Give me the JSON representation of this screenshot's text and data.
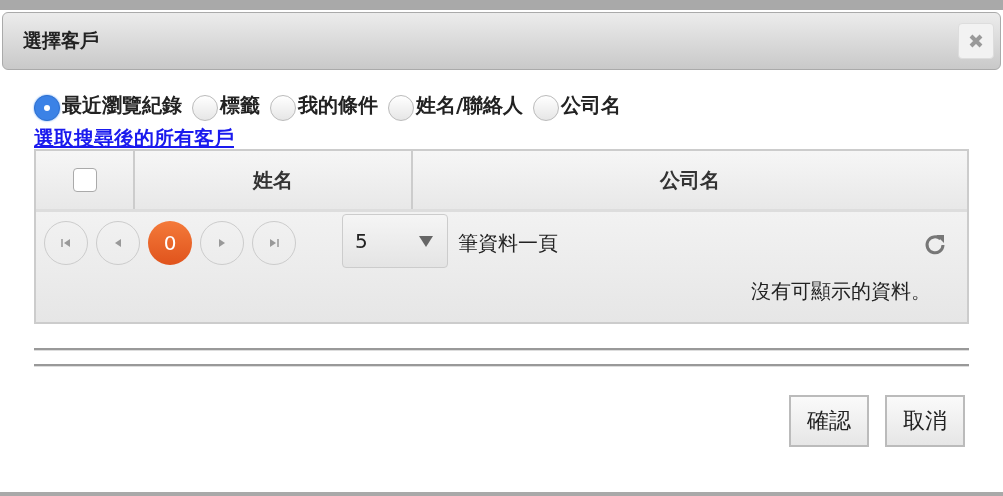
{
  "dialog": {
    "title": "選擇客戶"
  },
  "filters": [
    {
      "label": "最近瀏覽紀錄",
      "selected": true
    },
    {
      "label": "標籤",
      "selected": false
    },
    {
      "label": "我的條件",
      "selected": false
    },
    {
      "label": "姓名/聯絡人",
      "selected": false
    },
    {
      "label": "公司名",
      "selected": false
    }
  ],
  "select_all_link": "選取搜尋後的所有客戶",
  "grid": {
    "select_all_checked": false,
    "columns": [
      "姓名",
      "公司名"
    ],
    "pager": {
      "page": "0",
      "page_size": "5",
      "page_size_label": "筆資料一頁",
      "empty_message": "沒有可顯示的資料。"
    }
  },
  "buttons": [
    "確認",
    "取消"
  ]
}
